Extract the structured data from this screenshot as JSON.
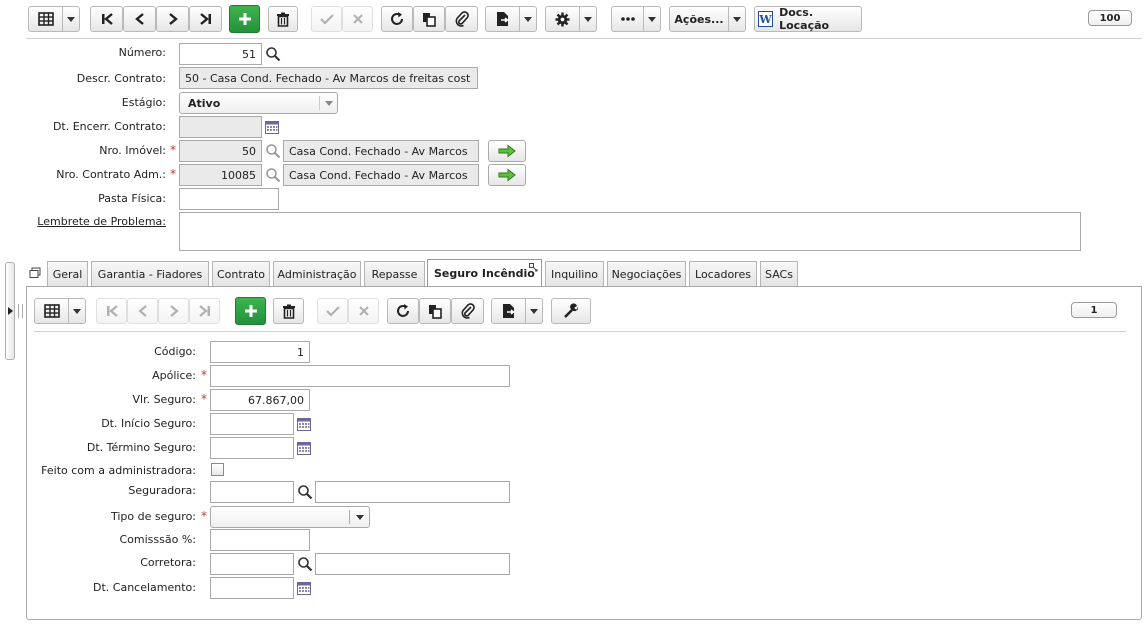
{
  "toolbar": {
    "actions_label": "Ações...",
    "docs_label": "Docs. Locação",
    "record_count": "100"
  },
  "form": {
    "numero_label": "Número:",
    "numero_value": "51",
    "descr_label": "Descr. Contrato:",
    "descr_value": "50 - Casa Cond. Fechado - Av Marcos de freitas cost",
    "estagio_label": "Estágio:",
    "estagio_value": "Ativo",
    "dt_encerr_label": "Dt. Encerr. Contrato:",
    "dt_encerr_value": "",
    "nro_imovel_label": "Nro. Imóvel:",
    "nro_imovel_value": "50",
    "nro_imovel_desc": "Casa Cond. Fechado - Av Marcos",
    "nro_contrato_label": "Nro. Contrato Adm.:",
    "nro_contrato_value": "10085",
    "nro_contrato_desc": "Casa Cond. Fechado - Av Marcos",
    "pasta_label": "Pasta Física:",
    "pasta_value": "",
    "lembrete_label": "Lembrete de Problema:",
    "lembrete_value": ""
  },
  "tabs": [
    {
      "label": "Geral"
    },
    {
      "label": "Garantia - Fiadores"
    },
    {
      "label": "Contrato"
    },
    {
      "label": "Administração"
    },
    {
      "label": "Repasse"
    },
    {
      "label": "Seguro Incêndio"
    },
    {
      "label": "Inquilino"
    },
    {
      "label": "Negociações"
    },
    {
      "label": "Locadores"
    },
    {
      "label": "SACs"
    }
  ],
  "active_tab": "Seguro Incêndio",
  "sub": {
    "record_count": "1",
    "codigo_label": "Código:",
    "codigo_value": "1",
    "apolice_label": "Apólice:",
    "apolice_value": "",
    "vlr_label": "Vlr. Seguro:",
    "vlr_value": "67.867,00",
    "dt_inicio_label": "Dt. Início Seguro:",
    "dt_inicio_value": "",
    "dt_termino_label": "Dt. Término Seguro:",
    "dt_termino_value": "",
    "feito_label": "Feito com a administradora:",
    "seguradora_label": "Seguradora:",
    "seguradora_value": "",
    "seguradora_desc": "",
    "tipo_label": "Tipo de seguro:",
    "tipo_value": "",
    "comissao_label": "Comisssão %:",
    "comissao_value": "",
    "corretora_label": "Corretora:",
    "corretora_value": "",
    "corretora_desc": "",
    "dt_cancel_label": "Dt. Cancelamento:",
    "dt_cancel_value": ""
  },
  "colors": {
    "accent_green": "#2a9a3f",
    "required_red": "#c0392b",
    "tab_border": "#b5b5b5"
  }
}
